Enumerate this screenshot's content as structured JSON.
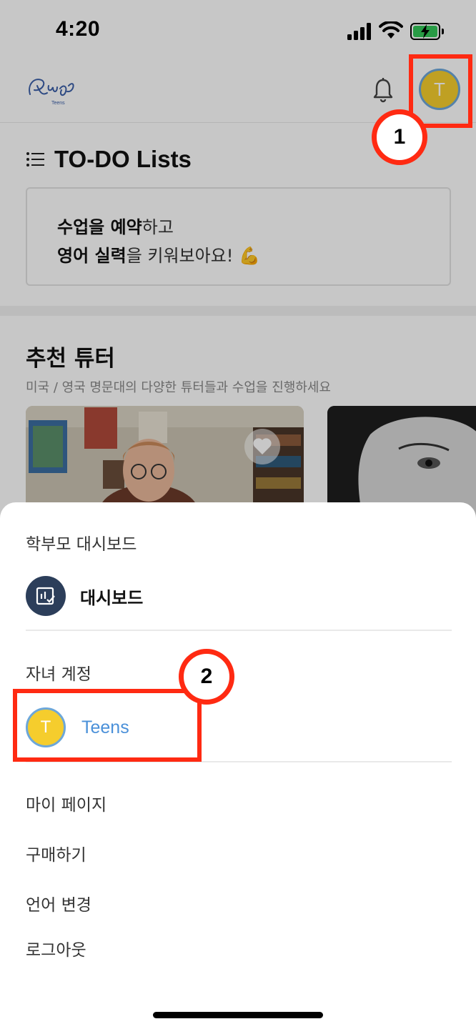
{
  "status_bar": {
    "time": "4:20"
  },
  "header": {
    "avatar_initial": "T"
  },
  "todo": {
    "title": "TO-DO Lists",
    "line1_bold": "수업을 예약",
    "line1_rest": "하고",
    "line2_bold": "영어 실력",
    "line2_rest": "을 키워보아요! 💪"
  },
  "recommended": {
    "title": "추천 튜터",
    "subtitle": "미국 / 영국 명문대의 다양한 튜터들과 수업을 진행하세요"
  },
  "sheet": {
    "parent_section": "학부모 대시보드",
    "dashboard_label": "대시보드",
    "child_section": "자녀 계정",
    "child_initial": "T",
    "child_name": "Teens",
    "menu": [
      "마이 페이지",
      "구매하기",
      "언어 변경",
      "로그아웃"
    ]
  },
  "annotations": {
    "step1": "1",
    "step2": "2"
  },
  "colors": {
    "highlight": "#ff2a12",
    "accent_blue": "#4a90d9",
    "avatar_yellow": "#f5cd2d",
    "dashboard_navy": "#2c3e5a"
  }
}
